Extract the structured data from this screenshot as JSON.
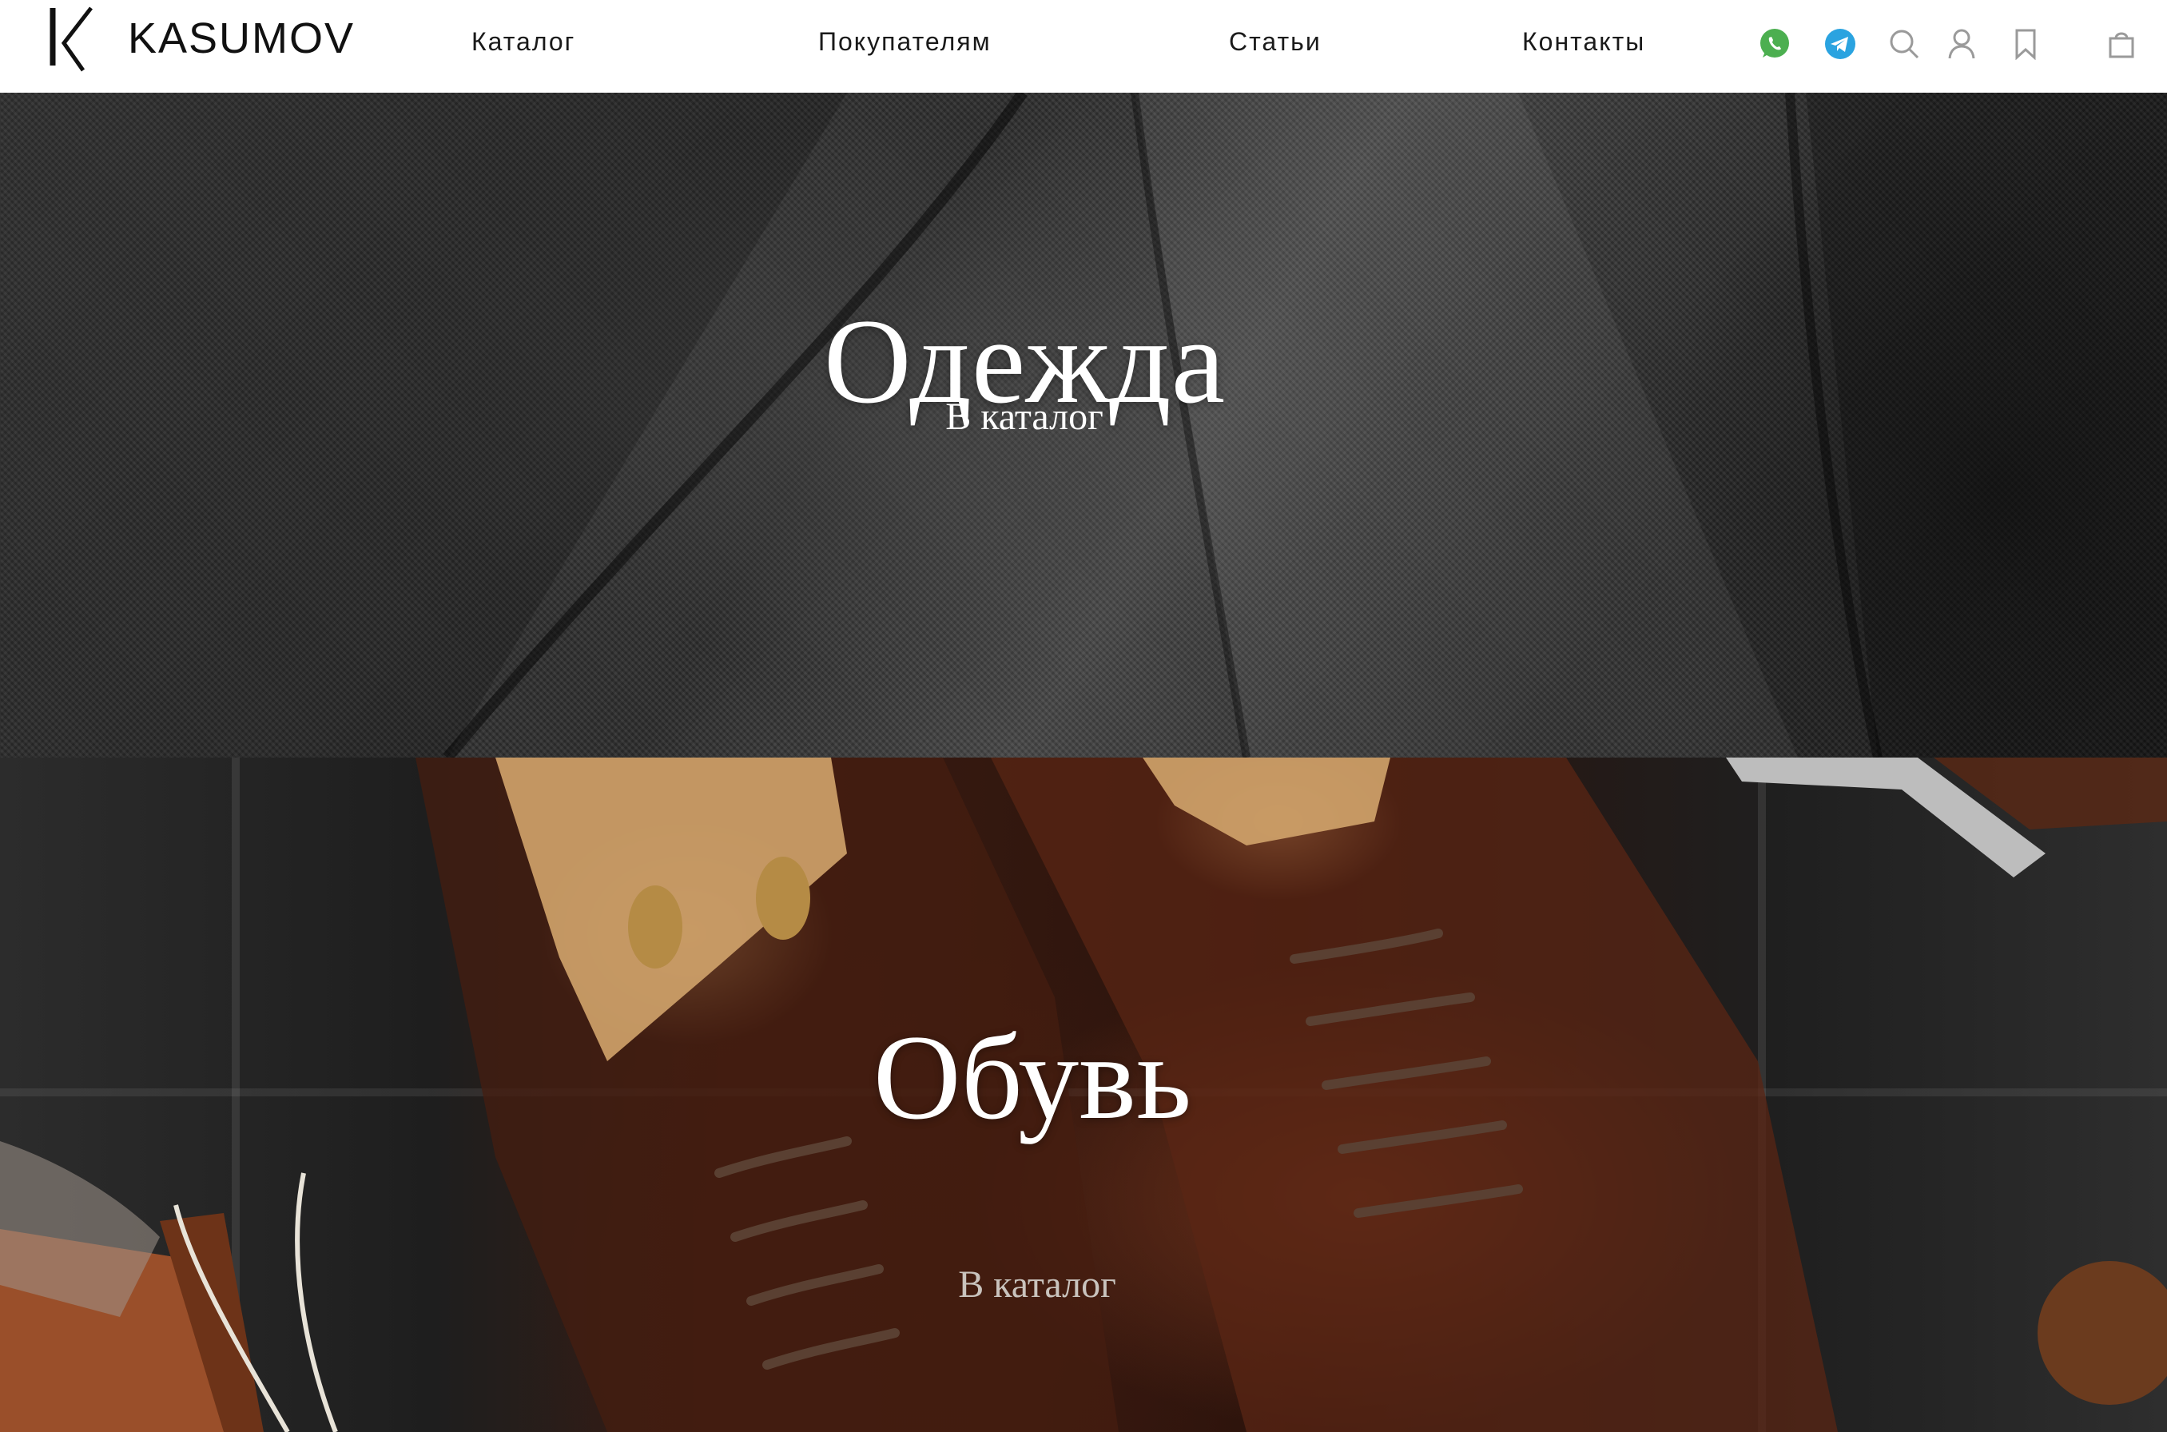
{
  "header": {
    "logo_text": "KASUMOV",
    "nav": {
      "catalog": "Каталог",
      "buyers": "Покупателям",
      "articles": "Статьи",
      "contacts": "Контакты"
    },
    "icons": [
      "whatsapp-icon",
      "telegram-icon",
      "search-icon",
      "user-icon",
      "bookmark-icon",
      "shopping-bag-icon"
    ]
  },
  "banners": {
    "clothes": {
      "title": "Одежда",
      "link": "В каталог"
    },
    "shoes": {
      "title": "Обувь",
      "link": "В каталог"
    }
  },
  "colors": {
    "header_bg": "#ffffff",
    "whatsapp": "#4caf50",
    "telegram": "#2aa3e0",
    "icon_gray": "#9a9a9a",
    "text_dark": "#1a1a1a"
  }
}
